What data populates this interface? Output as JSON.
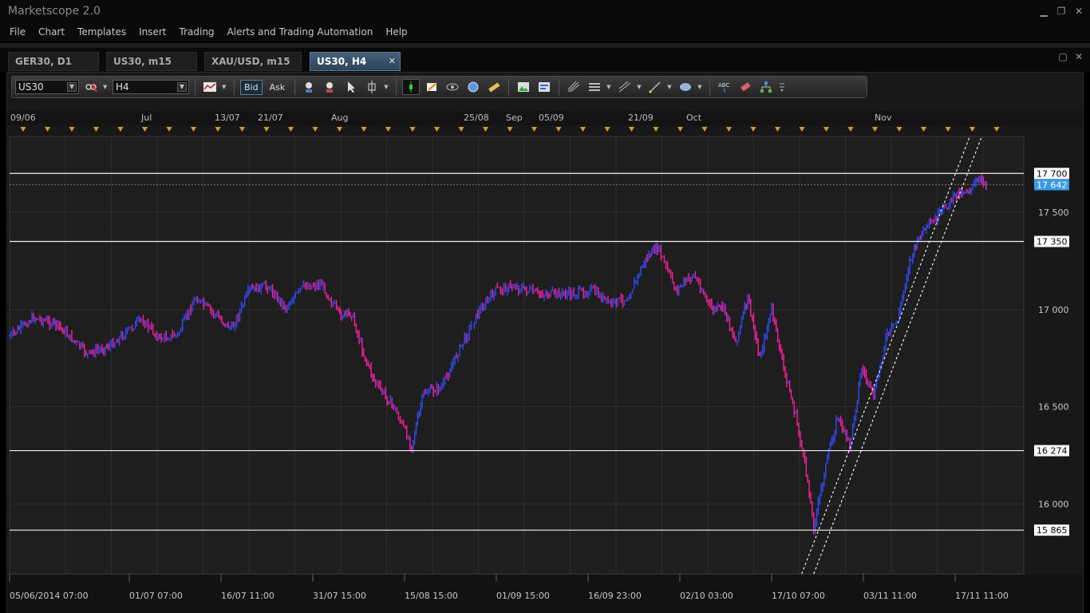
{
  "app": {
    "title": "Marketscope 2.0"
  },
  "menu": [
    "File",
    "Chart",
    "Templates",
    "Insert",
    "Trading",
    "Alerts and Trading Automation",
    "Help"
  ],
  "tabs": [
    {
      "label": "GER30, D1",
      "active": false
    },
    {
      "label": "US30, m15",
      "active": false
    },
    {
      "label": "XAU/USD, m15",
      "active": false
    },
    {
      "label": "US30, H4",
      "active": true
    }
  ],
  "toolbar": {
    "instrument": "US30",
    "timeframe": "H4",
    "bid_label": "Bid",
    "ask_label": "Ask",
    "icons": [
      "chart-type-icon",
      "zoom-in-icon",
      "zoom-out-icon",
      "cursor-icon",
      "crosshair-icon",
      "indicator-icon",
      "properties-icon",
      "eye-icon",
      "globe-icon",
      "ruler-icon",
      "image-icon",
      "template-icon",
      "fibonacci-icon",
      "levels-icon",
      "channel-icon",
      "line-icon",
      "ellipse-icon",
      "text-icon",
      "eraser-icon",
      "tree-icon",
      "more-icon"
    ]
  },
  "chart_data": {
    "type": "candlestick",
    "instrument": "US30",
    "timeframe": "H4",
    "top_date_labels": [
      "09/06",
      "Jul",
      "13/07",
      "21/07",
      "Aug",
      "25/08",
      "Sep",
      "05/09",
      "21/09",
      "Oct",
      "Nov"
    ],
    "x_tick_labels": [
      "05/06/2014 07:00",
      "01/07 07:00",
      "16/07 11:00",
      "31/07 15:00",
      "15/08 15:00",
      "01/09 15:00",
      "16/09 23:00",
      "02/10 03:00",
      "17/10 07:00",
      "03/11 11:00",
      "17/11 11:00"
    ],
    "y_tick_labels": [
      "17 500",
      "17 000",
      "16 500",
      "16 000"
    ],
    "y_ticks": [
      17500,
      17000,
      16500,
      16000
    ],
    "ylim": [
      15640,
      17890
    ],
    "current_price": {
      "value": 17642,
      "label": "17 642",
      "color": "#3a9ae8"
    },
    "horizontal_levels": [
      {
        "value": 17700,
        "label": "17 700"
      },
      {
        "value": 17350,
        "label": "17 350"
      },
      {
        "value": 16274,
        "label": "16 274"
      },
      {
        "value": 15865,
        "label": "15 865"
      }
    ],
    "channel_lines": [
      {
        "x": [
          "15/10",
          "12/11"
        ],
        "y": [
          15640,
          17890
        ]
      },
      {
        "x": [
          "17/10",
          "14/11"
        ],
        "y": [
          15640,
          17890
        ]
      }
    ],
    "price_path": [
      [
        "05/06",
        16860
      ],
      [
        "09/06",
        16960
      ],
      [
        "13/06",
        16920
      ],
      [
        "18/06",
        16770
      ],
      [
        "22/06",
        16820
      ],
      [
        "27/06",
        16950
      ],
      [
        "30/06",
        16850
      ],
      [
        "03/07",
        16870
      ],
      [
        "06/07",
        17060
      ],
      [
        "09/07",
        16980
      ],
      [
        "12/07",
        16900
      ],
      [
        "15/07",
        17100
      ],
      [
        "18/07",
        17120
      ],
      [
        "21/07",
        17010
      ],
      [
        "24/07",
        17120
      ],
      [
        "27/07",
        17130
      ],
      [
        "30/07",
        16970
      ],
      [
        "01/08",
        16980
      ],
      [
        "03/08",
        16770
      ],
      [
        "05/08",
        16620
      ],
      [
        "08/08",
        16500
      ],
      [
        "11/08",
        16300
      ],
      [
        "13/08",
        16570
      ],
      [
        "16/08",
        16600
      ],
      [
        "19/08",
        16800
      ],
      [
        "22/08",
        16980
      ],
      [
        "25/08",
        17100
      ],
      [
        "28/08",
        17120
      ],
      [
        "01/09",
        17080
      ],
      [
        "04/09",
        17080
      ],
      [
        "07/09",
        17080
      ],
      [
        "10/09",
        17100
      ],
      [
        "13/09",
        17030
      ],
      [
        "16/09",
        17060
      ],
      [
        "19/09",
        17260
      ],
      [
        "21/09",
        17320
      ],
      [
        "24/09",
        17100
      ],
      [
        "27/09",
        17180
      ],
      [
        "30/09",
        17000
      ],
      [
        "02/10",
        17010
      ],
      [
        "04/10",
        16830
      ],
      [
        "06/10",
        17060
      ],
      [
        "08/10",
        16750
      ],
      [
        "10/10",
        17000
      ],
      [
        "12/10",
        16700
      ],
      [
        "14/10",
        16450
      ],
      [
        "16/10",
        16120
      ],
      [
        "17/10",
        15880
      ],
      [
        "19/10",
        16200
      ],
      [
        "21/10",
        16450
      ],
      [
        "23/10",
        16300
      ],
      [
        "25/10",
        16700
      ],
      [
        "27/10",
        16550
      ],
      [
        "29/10",
        16850
      ],
      [
        "31/10",
        16950
      ],
      [
        "02/11",
        17250
      ],
      [
        "04/11",
        17400
      ],
      [
        "06/11",
        17450
      ],
      [
        "08/11",
        17530
      ],
      [
        "10/11",
        17600
      ],
      [
        "12/11",
        17620
      ],
      [
        "14/11",
        17670
      ],
      [
        "15/11",
        17642
      ]
    ]
  }
}
